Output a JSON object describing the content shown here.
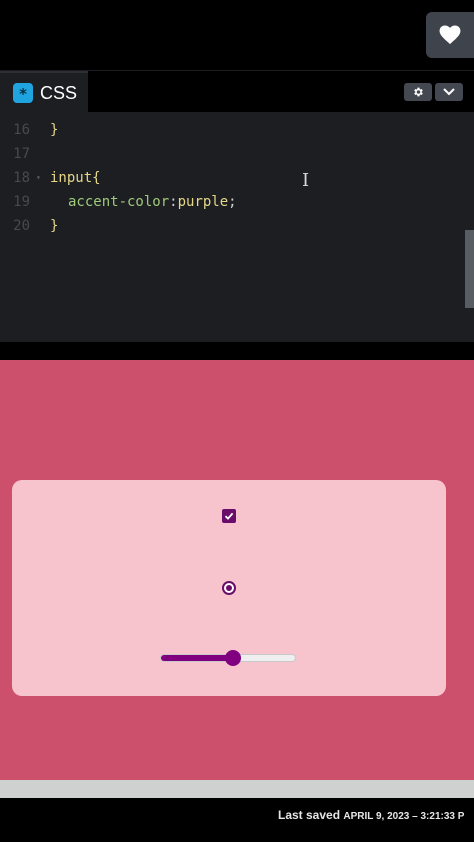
{
  "toolbar": {
    "heart_icon": "heart-icon"
  },
  "editor": {
    "tab_label": "CSS",
    "tab_badge": "*",
    "settings_icon": "gear-icon",
    "collapse_icon": "chevron-down-icon",
    "lines": [
      {
        "num": "16",
        "text": "}"
      },
      {
        "num": "17",
        "text": ""
      },
      {
        "num": "18",
        "selector": "input",
        "brace": "{"
      },
      {
        "num": "19",
        "property": "accent-color",
        "colon": ":",
        "value": "purple",
        "semi": ";"
      },
      {
        "num": "20",
        "text": "}"
      }
    ]
  },
  "preview": {
    "background": "#cc4f6c",
    "card_background": "#f7c4ce",
    "accent_color": "purple",
    "checkbox_checked": true,
    "radio_selected": true,
    "range_value_fraction": 0.54
  },
  "footer": {
    "label": "Last saved",
    "date": "APRIL 9, 2023",
    "separator": " – ",
    "time": "3:21:33 P"
  }
}
